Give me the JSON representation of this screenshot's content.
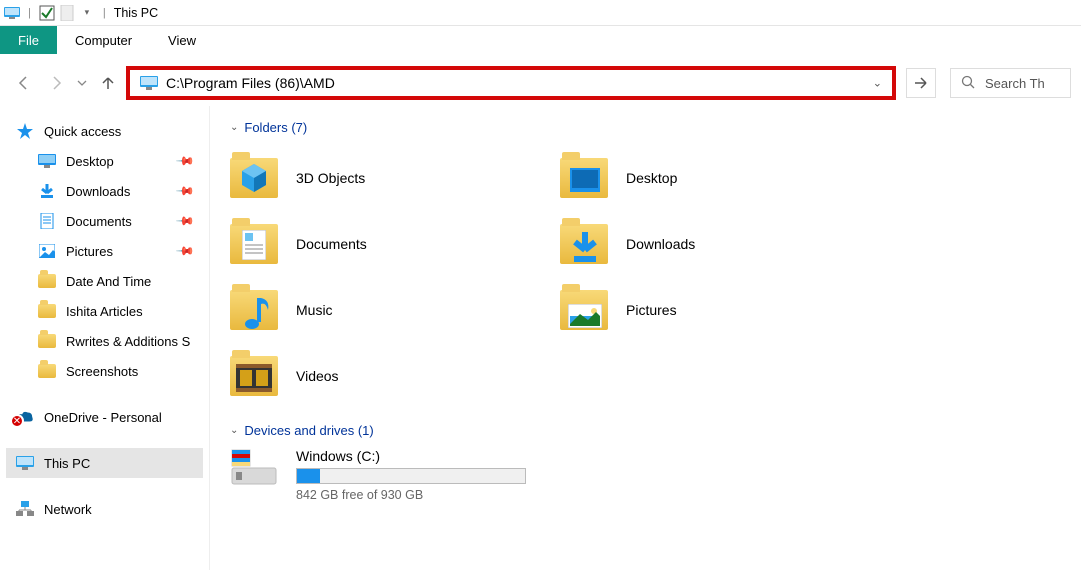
{
  "titlebar": {
    "title": "This PC",
    "sep": "|"
  },
  "ribbon": {
    "file": "File",
    "computer": "Computer",
    "view": "View"
  },
  "nav": {
    "address": "C:\\Program Files (86)\\AMD",
    "search_placeholder": "Search Th"
  },
  "sidebar": {
    "quick_access": "Quick access",
    "pinned": [
      {
        "label": "Desktop"
      },
      {
        "label": "Downloads"
      },
      {
        "label": "Documents"
      },
      {
        "label": "Pictures"
      }
    ],
    "recent": [
      {
        "label": "Date And Time"
      },
      {
        "label": "Ishita Articles"
      },
      {
        "label": "Rwrites & Additions S"
      },
      {
        "label": "Screenshots"
      }
    ],
    "onedrive": "OneDrive - Personal",
    "this_pc": "This PC",
    "network": "Network"
  },
  "main": {
    "folders_header": "Folders (7)",
    "folders": [
      {
        "label": "3D Objects"
      },
      {
        "label": "Desktop"
      },
      {
        "label": "Documents"
      },
      {
        "label": "Downloads"
      },
      {
        "label": "Music"
      },
      {
        "label": "Pictures"
      },
      {
        "label": "Videos"
      }
    ],
    "drives_header": "Devices and drives (1)",
    "drive": {
      "label": "Windows (C:)",
      "free_text": "842 GB free of 930 GB",
      "used_pct": 10
    }
  }
}
